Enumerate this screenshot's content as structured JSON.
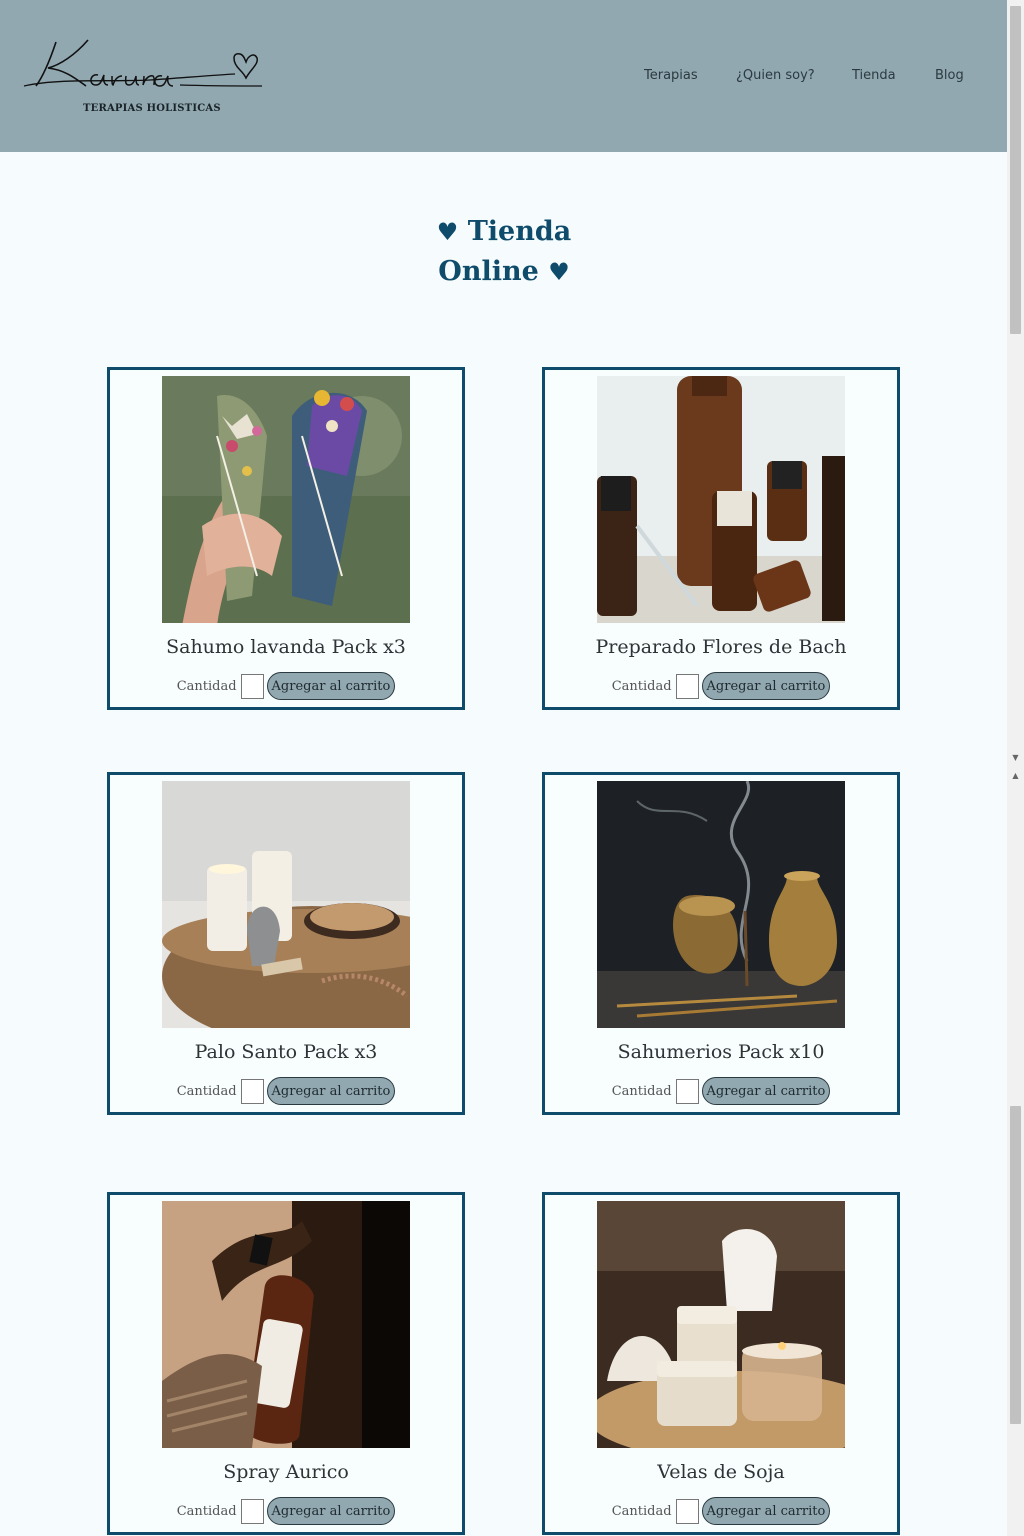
{
  "brand": {
    "logo_text": "Karuna",
    "tagline": "TERAPIAS HOLISTICAS"
  },
  "nav": [
    {
      "label": "Terapias"
    },
    {
      "label": "¿Quien soy?"
    },
    {
      "label": "Tienda"
    },
    {
      "label": "Blog"
    }
  ],
  "page": {
    "title_line1": "Tienda",
    "title_line2": "Online",
    "heart": "♥"
  },
  "products": [
    {
      "name": "Sahumo lavanda Pack x3",
      "image": "smudge-sticks-photo"
    },
    {
      "name": "Preparado Flores de Bach",
      "image": "essential-oil-bottles-photo"
    },
    {
      "name": "Palo Santo Pack x3",
      "image": "candles-palo-santo-photo"
    },
    {
      "name": "Sahumerios Pack x10",
      "image": "incense-brass-vase-photo"
    },
    {
      "name": "Spray Aurico",
      "image": "spray-bottle-photo"
    },
    {
      "name": "Velas de Soja",
      "image": "soy-candles-photo"
    }
  ],
  "product_ui": {
    "qty_label": "Cantidad",
    "add_label": "Agregar al carrito",
    "qty_value": ""
  },
  "colors": {
    "header_bg": "#91a8b1",
    "accent": "#0f4c6b",
    "page_bg": "#f6fcfd"
  }
}
